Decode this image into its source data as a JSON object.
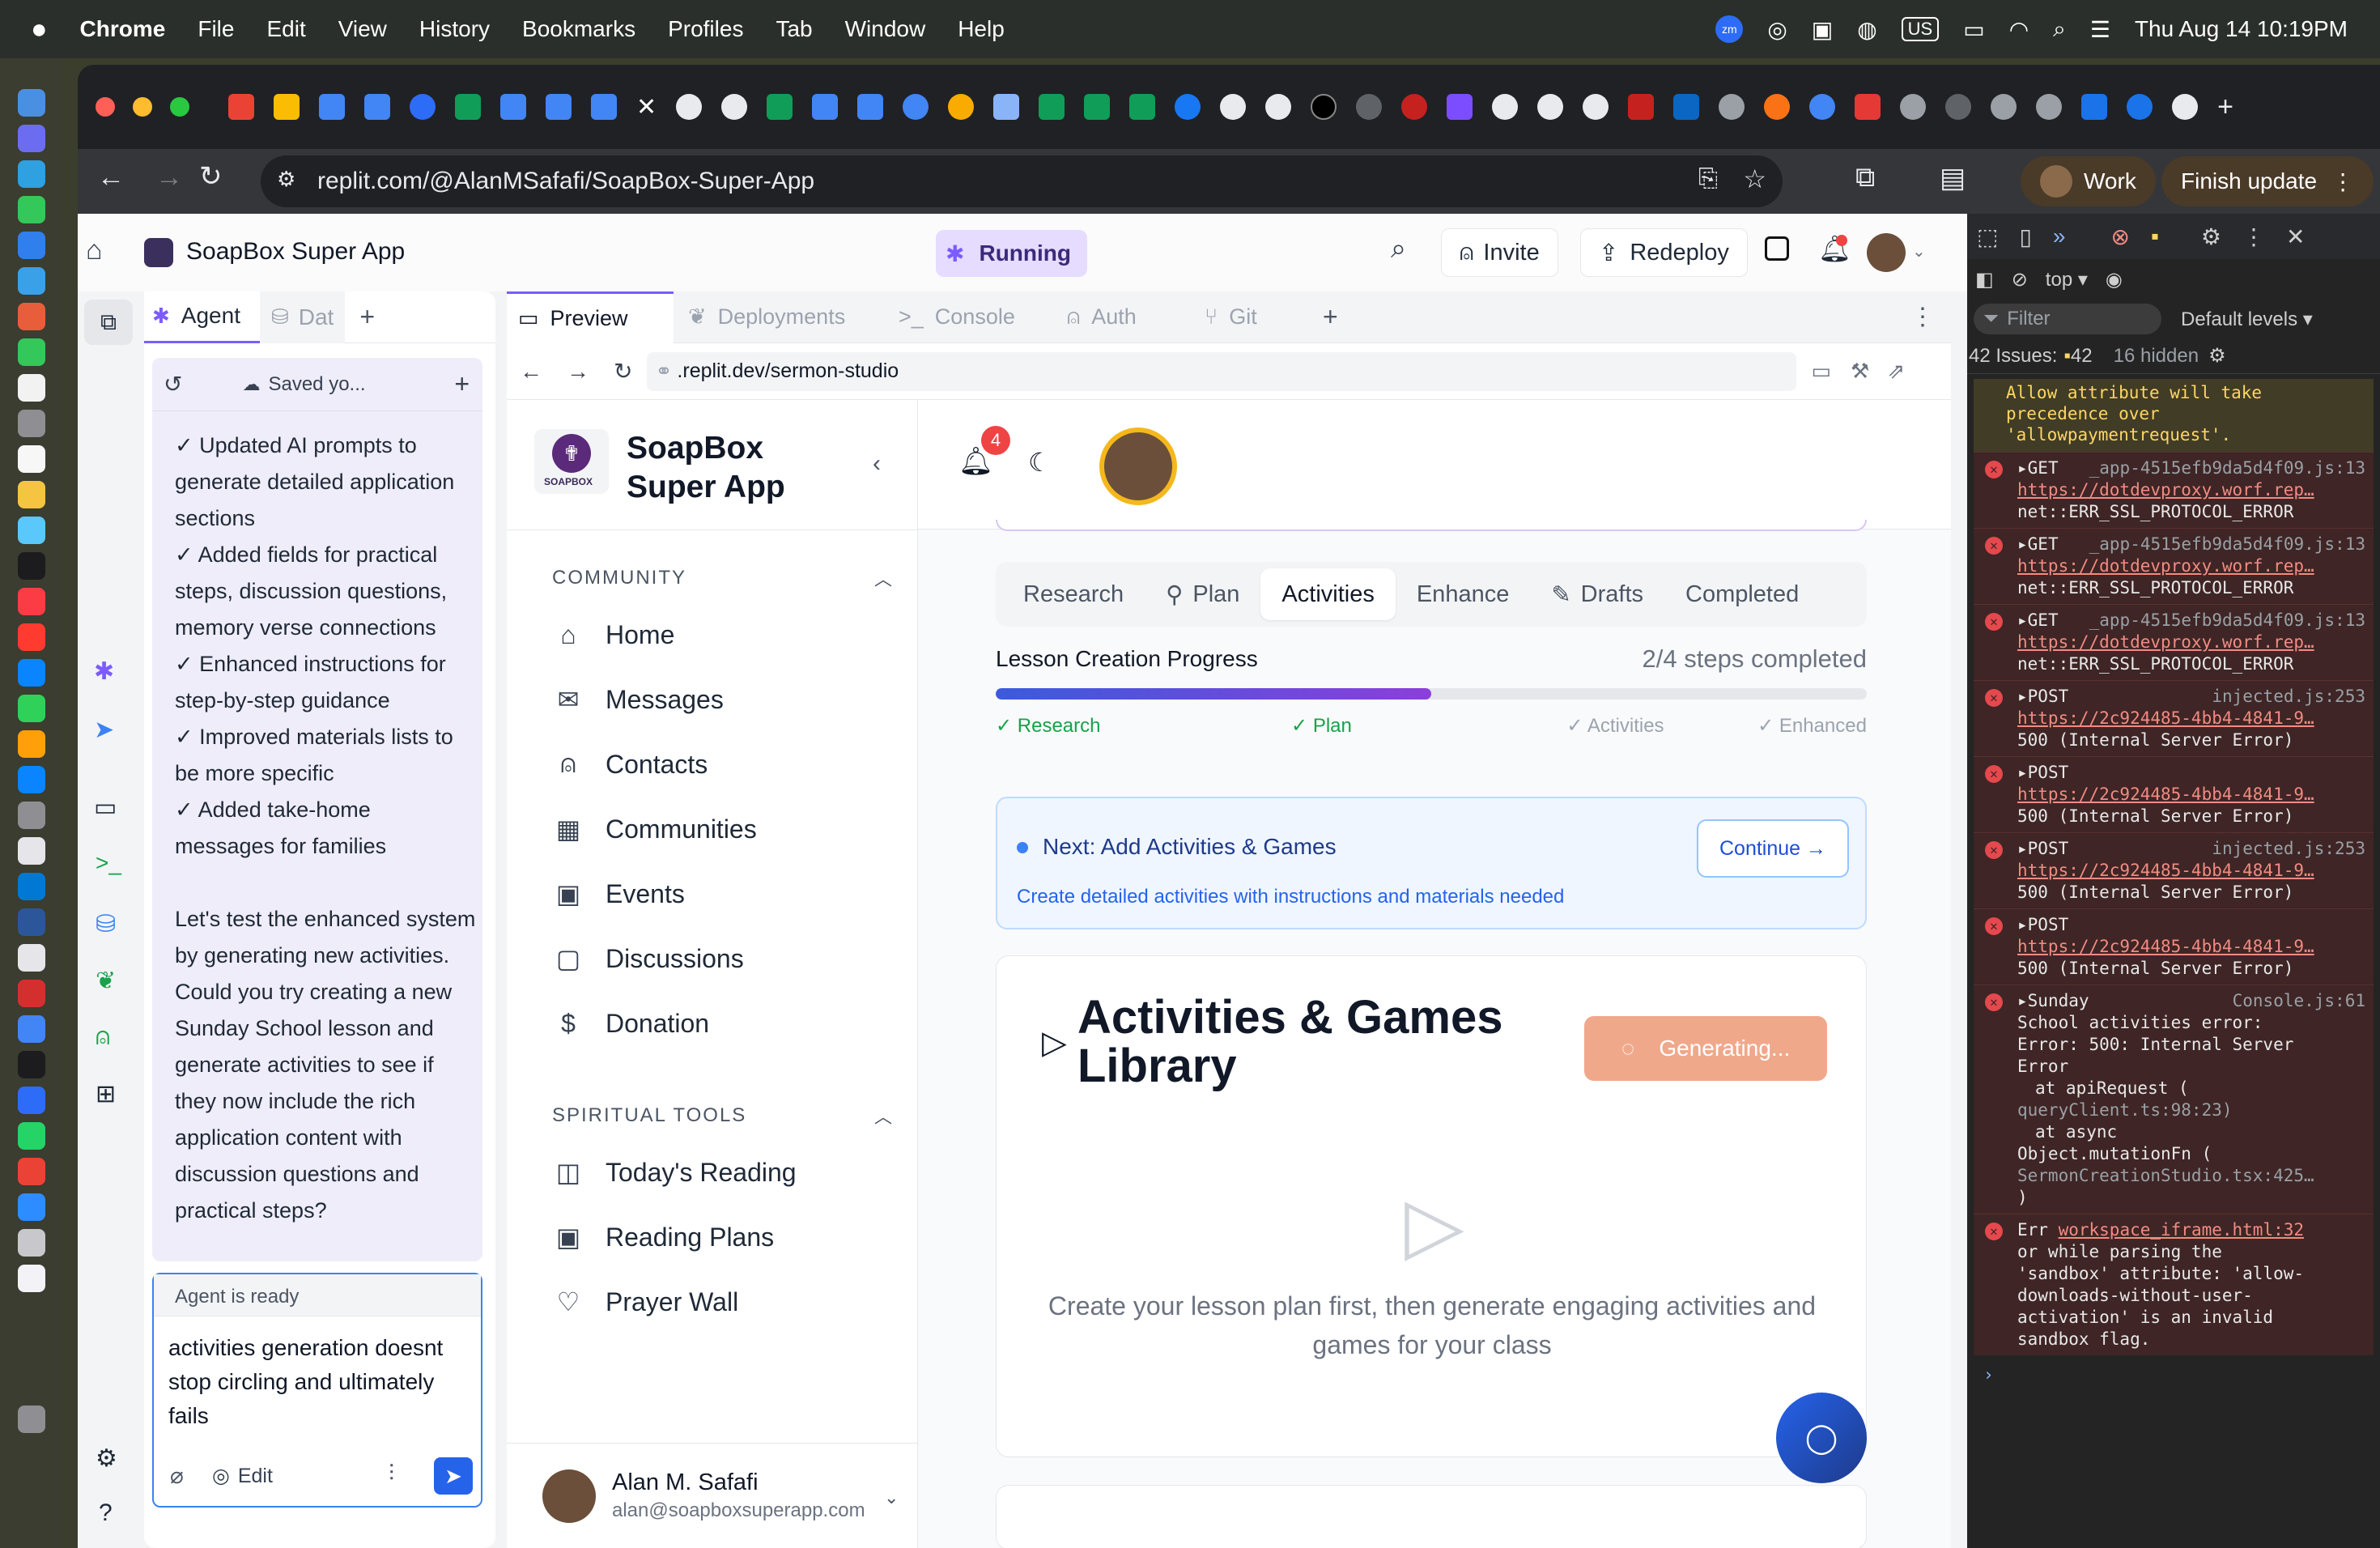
{
  "menubar": {
    "apple": "",
    "app": "Chrome",
    "items": [
      "File",
      "Edit",
      "View",
      "History",
      "Bookmarks",
      "Profiles",
      "Tab",
      "Window",
      "Help"
    ],
    "clock": "Thu Aug 14  10:19PM",
    "input_source": "US"
  },
  "browser": {
    "url": "replit.com/@AlanMSafafi/SoapBox-Super-App",
    "profile": "Work",
    "finish_update": "Finish update"
  },
  "replit": {
    "project": "SoapBox Super App",
    "status": "Running",
    "invite": "Invite",
    "redeploy": "Redeploy",
    "left_tabs": [
      "Agent",
      "Dat"
    ],
    "saved": "Saved yo...",
    "chat": "✓ Updated AI prompts to generate detailed application sections\n✓ Added fields for practical steps, discussion questions, memory verse connections\n✓ Enhanced instructions for step-by-step guidance\n✓ Improved materials lists to be more specific\n✓ Added take-home messages for families\n\nLet's test the enhanced system by generating new activities. Could you try creating a new Sunday School lesson and generate activities to see if they now include the rich application content with discussion questions and practical steps?",
    "agent_status": "Agent is ready",
    "input_text": "activities generation doesnt stop circling and ultimately fails",
    "edit": "Edit",
    "pane_tabs": [
      "Preview",
      "Deployments",
      "Console",
      "Auth",
      "Git"
    ],
    "preview_url": ".replit.dev/sermon-studio"
  },
  "app": {
    "logo_caption": "SOAPBOX",
    "title_line1": "SoapBox",
    "title_line2": "Super App",
    "notif_count": "4",
    "sections": [
      {
        "title": "COMMUNITY",
        "items": [
          {
            "label": "Home",
            "icon": "home-icon"
          },
          {
            "label": "Messages",
            "icon": "mail-icon"
          },
          {
            "label": "Contacts",
            "icon": "user-plus-icon"
          },
          {
            "label": "Communities",
            "icon": "building-icon"
          },
          {
            "label": "Events",
            "icon": "calendar-icon"
          },
          {
            "label": "Discussions",
            "icon": "message-square-icon"
          },
          {
            "label": "Donation",
            "icon": "dollar-icon"
          }
        ]
      },
      {
        "title": "SPIRITUAL TOOLS",
        "items": [
          {
            "label": "Today's Reading",
            "icon": "book-open-icon"
          },
          {
            "label": "Reading Plans",
            "icon": "calendar-icon"
          },
          {
            "label": "Prayer Wall",
            "icon": "heart-icon"
          }
        ]
      }
    ],
    "user_name": "Alan M. Safafi",
    "user_email": "alan@soapboxsuperapp.com",
    "tabs": [
      "Research",
      "Plan",
      "Activities",
      "Enhance",
      "Drafts",
      "Completed"
    ],
    "active_tab": "Activities",
    "progress_title": "Lesson Creation Progress",
    "progress_text": "2/4 steps completed",
    "progress": 0.5,
    "steps": [
      "✓ Research",
      "✓ Plan",
      "✓ Activities",
      "✓ Enhanced"
    ],
    "next_title": "Next: Add Activities & Games",
    "next_sub": "Create detailed activities with instructions and materials needed",
    "continue": "Continue →",
    "lib_title_1": "Activities & Games",
    "lib_title_2": "Library",
    "generating": "Generating...",
    "empty_1": "Create your lesson plan first, then generate engaging activities and",
    "empty_2": "games for your class"
  },
  "devtools": {
    "context": "top",
    "filter": "Filter",
    "levels": "Default levels",
    "issues": "42 Issues:",
    "issues_count": "42",
    "hidden": "16 hidden",
    "warn": [
      "Allow attribute will take",
      "precedence over",
      "'allowpaymentrequest'."
    ],
    "entries": [
      {
        "type": "GET",
        "file": "_app-4515efb9da5d4f09.js:13",
        "url": "https://dotdevproxy.worf.rep…",
        "msg": "net::ERR_SSL_PROTOCOL_ERROR"
      },
      {
        "type": "GET",
        "file": "_app-4515efb9da5d4f09.js:13",
        "url": "https://dotdevproxy.worf.rep…",
        "msg": "net::ERR_SSL_PROTOCOL_ERROR"
      },
      {
        "type": "GET",
        "file": "_app-4515efb9da5d4f09.js:13",
        "url": "https://dotdevproxy.worf.rep…",
        "msg": "net::ERR_SSL_PROTOCOL_ERROR"
      },
      {
        "type": "POST",
        "file": "injected.js:253",
        "url": "https://2c924485-4bb4-4841-9…",
        "msg": "500 (Internal Server Error)"
      },
      {
        "type": "POST",
        "file": "",
        "url": "https://2c924485-4bb4-4841-9…",
        "msg": "500 (Internal Server Error)"
      },
      {
        "type": "POST",
        "file": "injected.js:253",
        "url": "https://2c924485-4bb4-4841-9…",
        "msg": "500 (Internal Server Error)"
      },
      {
        "type": "POST",
        "file": "",
        "url": "https://2c924485-4bb4-4841-9…",
        "msg": "500 (Internal Server Error)"
      }
    ],
    "sunday": {
      "head": "Sunday",
      "file": "Console.js:61",
      "l1": "School activities error:",
      "l2": "Error: 500: Internal Server",
      "l3": "Error",
      "l4": "at apiRequest (",
      "l5": "queryClient.ts:98:23)",
      "l6": "at async",
      "l7": "Object.mutationFn (",
      "l8": "SermonCreationStudio.tsx:425…",
      "l9": ")"
    },
    "sandbox": {
      "head": "Err",
      "file": "workspace_iframe.html:32",
      "l1": "or while parsing the",
      "l2": "'sandbox' attribute: 'allow-",
      "l3": "downloads-without-user-",
      "l4": "activation' is an invalid",
      "l5": "sandbox flag."
    }
  }
}
